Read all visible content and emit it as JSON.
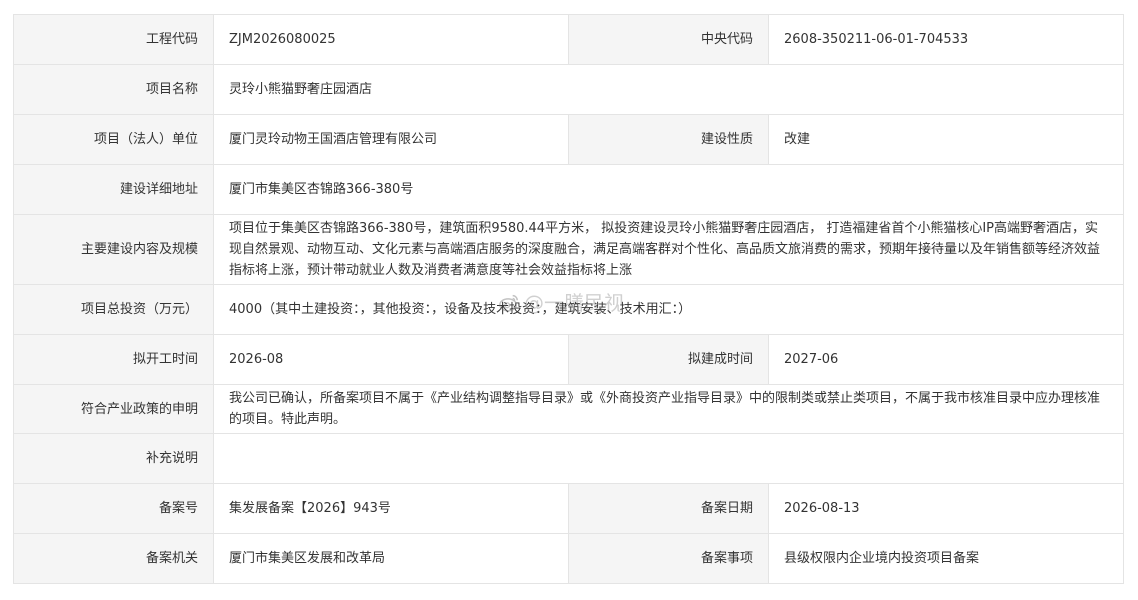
{
  "rows": [
    {
      "label": "工程代码",
      "value": "ZJM2026080025",
      "label2": "中央代码",
      "value2": "2608-350211-06-01-704533"
    },
    {
      "label": "项目名称",
      "value": "灵玲小熊猫野奢庄园酒店"
    },
    {
      "label": "项目（法人）单位",
      "value": "厦门灵玲动物王国酒店管理有限公司",
      "label2": "建设性质",
      "value2": "改建"
    },
    {
      "label": "建设详细地址",
      "value": "厦门市集美区杏锦路366-380号"
    },
    {
      "label": "主要建设内容及规模",
      "value": "项目位于集美区杏锦路366-380号，建筑面积9580.44平方米， 拟投资建设灵玲小熊猫野奢庄园酒店， 打造福建省首个小熊猫核心IP高端野奢酒店，实现自然景观、动物互动、文化元素与高端酒店服务的深度融合，满足高端客群对个性化、高品质文旅消费的需求，预期年接待量以及年销售额等经济效益指标将上涨，预计带动就业人数及消费者满意度等社会效益指标将上涨"
    },
    {
      "label": "项目总投资（万元）",
      "value": "4000（其中土建投资：，其他投资：，设备及技术投资：，建筑安装、技术用汇：）"
    },
    {
      "label": "拟开工时间",
      "value": "2026-08",
      "label2": "拟建成时间",
      "value2": "2027-06"
    },
    {
      "label": "符合产业政策的申明",
      "value": "我公司已确认，所备案项目不属于《产业结构调整指导目录》或《外商投资产业指导目录》中的限制类或禁止类项目，不属于我市核准目录中应办理核准的项目。特此声明。"
    },
    {
      "label": "补充说明",
      "value": ""
    },
    {
      "label": "备案号",
      "value": "集发展备案【2026】943号",
      "label2": "备案日期",
      "value2": "2026-08-13"
    },
    {
      "label": "备案机关",
      "value": "厦门市集美区发展和改革局",
      "label2": "备案事项",
      "value2": "县级权限内企业境内投资项目备案"
    }
  ],
  "watermark": {
    "text": "@一膳民视",
    "icon": "weibo-logo-icon"
  },
  "colors": {
    "label_bg": "#f5f5f5",
    "border": "#e4e4e4",
    "text": "#333333"
  }
}
